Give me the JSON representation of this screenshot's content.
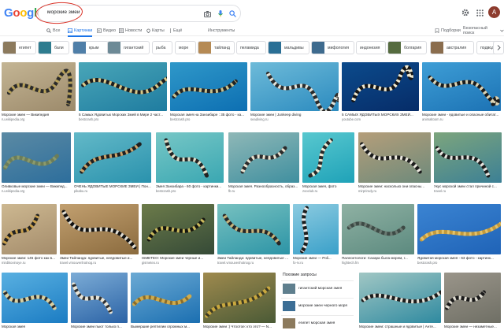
{
  "header": {
    "logo": [
      "G",
      "o",
      "o",
      "g",
      "l",
      "e"
    ],
    "logo_colors": [
      "#4285f4",
      "#ea4335",
      "#fbbc05",
      "#4285f4",
      "#34a853",
      "#ea4335"
    ],
    "query": "морские змеи",
    "avatar_letter": "А"
  },
  "tabs": [
    {
      "label": "Все",
      "icon": "search-icon"
    },
    {
      "label": "Картинки",
      "icon": "image-icon",
      "active": true
    },
    {
      "label": "Видео",
      "icon": "video-icon"
    },
    {
      "label": "Новости",
      "icon": "news-icon"
    },
    {
      "label": "Карты",
      "icon": "map-pin-icon"
    },
    {
      "label": "Ещё",
      "icon": "more-icon"
    },
    {
      "label": "Инструменты"
    }
  ],
  "right_tabs": {
    "collections": "Подборки",
    "safesearch": "Безопасный поиск"
  },
  "chips": [
    {
      "label": "египет",
      "thumb": "#8c7a5d"
    },
    {
      "label": "бали",
      "thumb": "#2e7c8f"
    },
    {
      "label": "крым",
      "thumb": "#4f7fa8"
    },
    {
      "label": "гигантский",
      "thumb": "#6d8a96"
    },
    {
      "label": "рыба",
      "thumb": null
    },
    {
      "label": "море",
      "thumb": null
    },
    {
      "label": "тайланд",
      "thumb": "#b58a54"
    },
    {
      "label": "пеламида",
      "thumb": null
    },
    {
      "label": "мальдивы",
      "thumb": "#2a6f95"
    },
    {
      "label": "мифология",
      "thumb": "#3e6b8e"
    },
    {
      "label": "индонезия",
      "thumb": null
    },
    {
      "label": "болгария",
      "thumb": "#556b3f"
    },
    {
      "label": "австралия",
      "thumb": "#8a6d4e"
    },
    {
      "label": "подвод",
      "thumb": null
    }
  ],
  "results": [
    {
      "title": "Морские змеи — Википедия",
      "source": "ru.wikipedia.org",
      "bg": "#9c8a6b",
      "bg2": "#c4b594",
      "snake": "#2b2b2b",
      "band": "#b7a15a"
    },
    {
      "title": "5 Самых Ядовитых Морских Змей в Мире 2 част...",
      "source": "bestcrash.pro",
      "bg": "#1f7ca0",
      "bg2": "#49a6b8",
      "snake": "#1d1d1d",
      "band": "#d8c88a"
    },
    {
      "title": "Морская змея на Занзибаре : 35 фото - ка...",
      "source": "bestcrash.pro",
      "bg": "#0d6fb2",
      "bg2": "#2f98c9",
      "snake": "#222",
      "band": "#c9c28f"
    },
    {
      "title": "Морские змеи | Junkeep diving",
      "source": "seadiving.ru",
      "bg": "#2c8bbf",
      "bg2": "#6ebbd9",
      "snake": "#2a2a2a",
      "band": "#e2e2d8"
    },
    {
      "title": "5 САМЫХ ЯДОВИТЫХ МОРСКИХ ЗМЕЙ...",
      "source": "youtube.com",
      "bg": "#062c68",
      "bg2": "#0c4b8c",
      "snake": "#151515",
      "band": "#f0e9d0"
    },
    {
      "title": "Морские змеи - ядовитые и опасные обитат...",
      "source": "animaltoom.ru",
      "bg": "#1c72b4",
      "bg2": "#3e9ed6",
      "snake": "#1b1b1b",
      "band": "#d9d2b4"
    },
    {
      "title": "Оливковые морские змеи — Википед...",
      "source": "ru.wikipedia.org",
      "bg": "#2d6e9c",
      "bg2": "#5b8aa4",
      "snake": "#6b7d5a",
      "band": "#8b9a6b"
    },
    {
      "title": "ОЧЕНЬ ЯДОВИТЫЕ МОРСКИЕ ЗМЕИ | Пон...",
      "source": "pikabu.ru",
      "bg": "#2a92ad",
      "bg2": "#63b9c8",
      "snake": "#1f1f1f",
      "band": "#caa36a"
    },
    {
      "title": "Змея Занзибара - 60 фото - картинки...",
      "source": "bestcrash.pro",
      "bg": "#3aa7b2",
      "bg2": "#77c7c6",
      "snake": "#222",
      "band": "#e3dfc8"
    },
    {
      "title": "Морская змея. Разнообразность, образ...",
      "source": "fb.ru",
      "bg": "#3f8f9f",
      "bg2": "#8fb8b7",
      "snake": "#2b2b2b",
      "band": "#e8e3d1"
    },
    {
      "title": "Морская змея, фото",
      "source": "zooclub.ru",
      "bg": "#1fa2b8",
      "bg2": "#58c8cf",
      "snake": "#292929",
      "band": "#f0ecd6"
    },
    {
      "title": "Морские змеи: насколько они опасны...",
      "source": "mirprirody.ru",
      "bg": "#6d8a7b",
      "bg2": "#b59e7a",
      "snake": "#1b1b1b",
      "band": "#e9e6dd"
    },
    {
      "title": "Укус морской змеи стал причиной с...",
      "source": "travel.ru",
      "bg": "#3c8095",
      "bg2": "#7da57d",
      "snake": "#1a1a1a",
      "band": "#e4e3de"
    },
    {
      "title": "Морские змеи: 145 фото как в...",
      "source": "mirdikovinoye.ru",
      "bg": "#a48c6b",
      "bg2": "#cdb891",
      "snake": "#222",
      "band": "#c9a04c"
    },
    {
      "title": "Змеи Тайланда: ядовитые, неядовитые и...",
      "source": "travel.vmouvenhotnog.ru",
      "bg": "#8b6b3e",
      "bg2": "#c2a070",
      "snake": "#111",
      "band": "#dfdcd2"
    },
    {
      "title": "ISMETEO: Морские змеи черные и...",
      "source": "gismeteo.ru",
      "bg": "#354a37",
      "bg2": "#6c7b4a",
      "snake": "#15150f",
      "band": "#c9b95c"
    },
    {
      "title": "Змеи Тайланда: ядовитые, неядовитые и...",
      "source": "travel.vmouvenhotnog.ru",
      "bg": "#2c94a6",
      "bg2": "#77c1c0",
      "snake": "#262626",
      "band": "#c6b37b"
    },
    {
      "title": "Морские змеи — Poli...",
      "source": "fo-rv.ru",
      "bg": "#3aa0c9",
      "bg2": "#8ccbe0",
      "snake": "#1d1d1d",
      "band": "#eaeaea"
    },
    {
      "title": "Палеонтологи: Сахара была морем, г...",
      "source": "hightech.fm",
      "bg": "#5c8a7f",
      "bg2": "#8fb1a3",
      "snake": "#3d4a45",
      "band": "#6a7a72"
    },
    {
      "title": "Ядовитая морская змея - 63 фото - картинк...",
      "source": "bestcrash.pro",
      "bg": "#1f63b7",
      "bg2": "#3b84d2",
      "snake": "#c49a3b",
      "band": "#e3c26b"
    },
    {
      "title": "Морская змея",
      "source": "",
      "bg": "#1b7cc3",
      "bg2": "#59b0e1",
      "snake": "#d9d0a2",
      "band": "#2b2b2b"
    },
    {
      "title": "Морские змеи пьют только п...",
      "source": "",
      "bg": "#2b63a6",
      "bg2": "#7cacd6",
      "snake": "#e8e5d8",
      "band": "#303030"
    },
    {
      "title": "Вымершие рептилии огромных м...",
      "source": "",
      "bg": "#1b6fb1",
      "bg2": "#6caad4",
      "snake": "#cfab4d",
      "band": "#8a6c2a"
    },
    {
      "title": "Морские змеи :) Чтоотоe: кто это? — N...",
      "source": "",
      "bg": "#4a5a36",
      "bg2": "#9f8a4e",
      "snake": "#c9a83f",
      "band": "#3d3a22"
    },
    {
      "title": "Морские змеи: страшные и ядовитые | Анте...",
      "source": "",
      "bg": "#2f8aa0",
      "bg2": "#a1c7c4",
      "snake": "#1c1c1c",
      "band": "#e3e1d6"
    },
    {
      "title": "Морские змеи — незаметные...",
      "source": "",
      "bg": "#6f6f65",
      "bg2": "#9a958a",
      "snake": "#1a1a1a",
      "band": "#dedbd0"
    }
  ],
  "related": {
    "heading": "Похожие запросы",
    "items": [
      {
        "label": "гигантский морская змея",
        "thumb": "#5f7f8e"
      },
      {
        "label": "морские змеи черного моря",
        "thumb": "#3c6e95"
      },
      {
        "label": "египет морская змея",
        "thumb": "#8c7a5d"
      }
    ]
  }
}
